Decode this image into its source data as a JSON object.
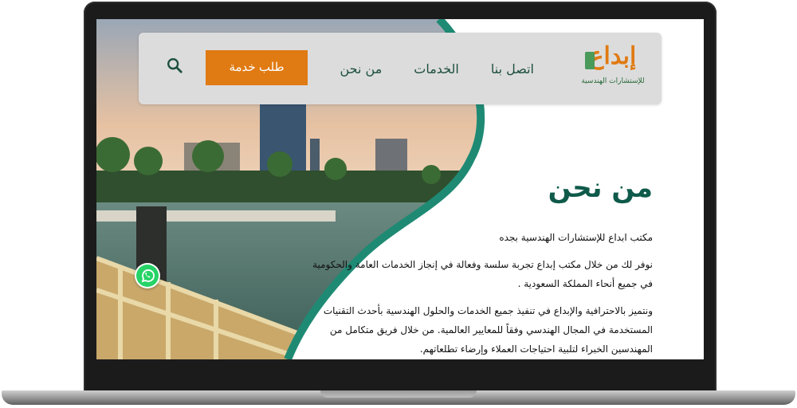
{
  "header": {
    "logo": {
      "word": "إبداع",
      "subtitle": "للإستشارات الهندسية"
    },
    "nav": [
      {
        "label": "من نحن"
      },
      {
        "label": "الخدمات"
      },
      {
        "label": "اتصل بنا"
      }
    ],
    "service_button": "طلب خدمة",
    "search_icon": "search-icon"
  },
  "about": {
    "title": "من نحن",
    "paragraphs": [
      "مكتب ابداع للإستشارات الهندسية بجده",
      "نوفر لك من خلال مكتب إبداع تجربة سلسة وفعالة في إنجاز الخدمات العامة والحكومية في جميع أنحاء المملكة السعودية .",
      "ونتميز بالاحترافية والإبداع في تنفيذ جميع الخدمات والحلول الهندسية بأحدث التقنيات المستخدمة في المجال الهندسي وفقاً للمعايير العالمية. من خلال فريق متكامل من المهندسين الخبراء لتلبية احتياجات العملاء وإرضاء تطلعاتهم."
    ]
  },
  "floating": {
    "whatsapp_icon": "whatsapp-icon"
  },
  "colors": {
    "accent_orange": "#e07a12",
    "brand_green": "#0f5a4a",
    "teal_curve": "#1f8a74"
  }
}
